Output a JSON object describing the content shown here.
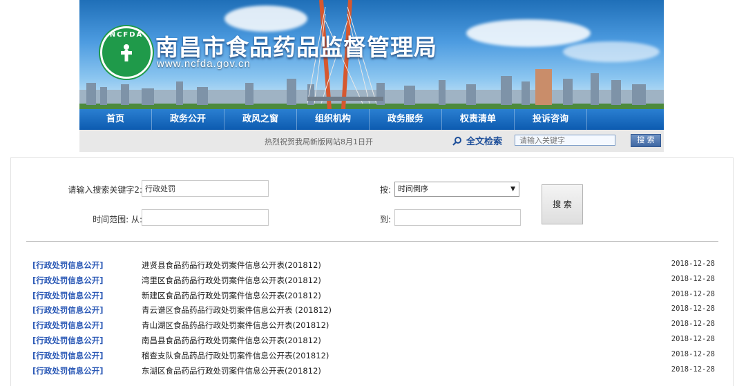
{
  "header": {
    "logo_letters": "NCFDA",
    "title": "南昌市食品药品监督管理局",
    "url": "www.ncfda.gov.cn"
  },
  "nav": [
    "首页",
    "政务公开",
    "政风之窗",
    "组织机构",
    "政务服务",
    "权责清单",
    "投诉咨询"
  ],
  "subbar": {
    "welcome": "热烈祝贺我局新版网站8月1日开",
    "fulltext_label": "全文检索",
    "search_placeholder": "请输入关键字",
    "search_button": "搜 索"
  },
  "form": {
    "keyword_label": "请输入搜索关键字2:",
    "keyword_value": "行政处罚",
    "order_label": "按:",
    "order_value": "时间倒序",
    "time_from_label": "时间范围: 从:",
    "time_to_label": "到:",
    "search_button": "搜 索"
  },
  "results": [
    {
      "category": "[行政处罚信息公开]",
      "title": "进贤县食品药品行政处罚案件信息公开表(201812)",
      "date": "2018-12-28"
    },
    {
      "category": "[行政处罚信息公开]",
      "title": "湾里区食品药品行政处罚案件信息公开表(201812)",
      "date": "2018-12-28"
    },
    {
      "category": "[行政处罚信息公开]",
      "title": "新建区食品药品行政处罚案件信息公开表(201812)",
      "date": "2018-12-28"
    },
    {
      "category": "[行政处罚信息公开]",
      "title": "青云谱区食品药品行政处罚案件信息公开表 (201812)",
      "date": "2018-12-28"
    },
    {
      "category": "[行政处罚信息公开]",
      "title": "青山湖区食品药品行政处罚案件信息公开表(201812)",
      "date": "2018-12-28"
    },
    {
      "category": "[行政处罚信息公开]",
      "title": "南昌县食品药品行政处罚案件信息公开表(201812)",
      "date": "2018-12-28"
    },
    {
      "category": "[行政处罚信息公开]",
      "title": "稽查支队食品药品行政处罚案件信息公开表(201812)",
      "date": "2018-12-28"
    },
    {
      "category": "[行政处罚信息公开]",
      "title": "东湖区食品药品行政处罚案件信息公开表(201812)",
      "date": "2018-12-28"
    }
  ]
}
